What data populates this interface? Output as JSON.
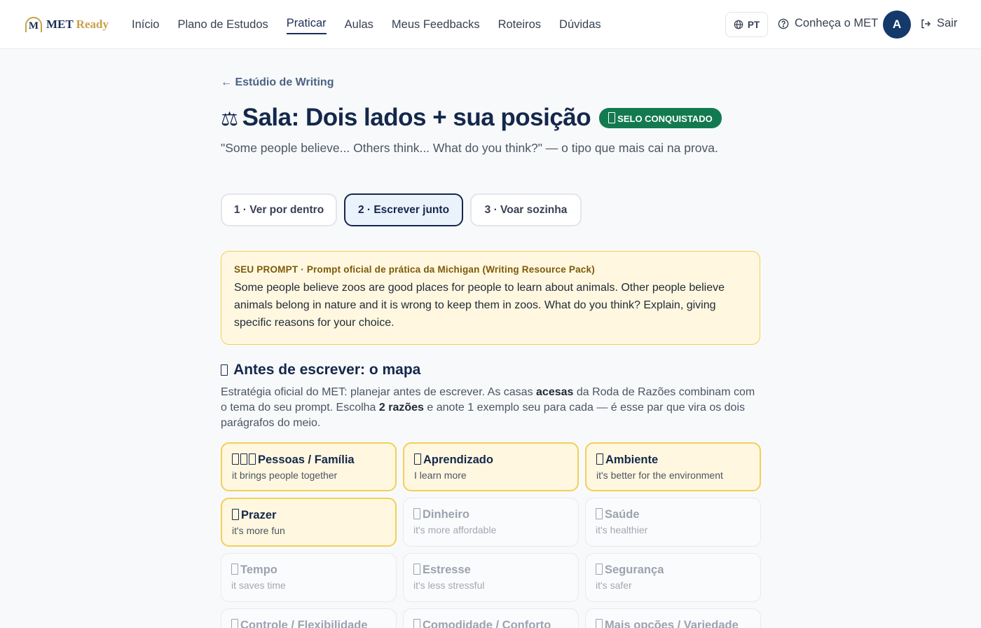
{
  "header": {
    "logo_letter": "M",
    "logo_text_a": "MET",
    "logo_text_b": "Ready",
    "nav": [
      "Início",
      "Plano de Estudos",
      "Praticar",
      "Aulas",
      "Meus Feedbacks",
      "Roteiros",
      "Dúvidas"
    ],
    "active_nav": "Praticar",
    "lang": "PT",
    "meet_label": "Conheça o MET",
    "avatar_initial": "A",
    "logout_label": "Sair"
  },
  "page": {
    "back_label": "← Estúdio de Writing",
    "title_icon": "⚖",
    "title": "Sala: Dois lados + sua posição",
    "badge": "SELO CONQUISTADO",
    "subtitle": "\"Some people believe... Others think... What do you think?\" — o tipo que mais cai na prova.",
    "steps": [
      "1 · Ver por dentro",
      "2 · Escrever junto",
      "3 · Voar sozinha"
    ],
    "active_step": 1
  },
  "prompt": {
    "label": "SEU PROMPT · Prompt oficial de prática da Michigan (Writing Resource Pack)",
    "text": "Some people believe zoos are good places for people to learn about animals. Other people believe animals belong in nature and it is wrong to keep them in zoos. What do you think? Explain, giving specific reasons for your choice."
  },
  "planning": {
    "title": "Antes de escrever: o mapa",
    "desc_1": "Estratégia oficial do MET: planejar antes de escrever. As casas ",
    "desc_b1": "acesas",
    "desc_2": " da Roda de Razões combinam com o tema do seu prompt. Escolha ",
    "desc_b2": "2 razões",
    "desc_3": " e anote 1 exemplo seu para cada — é esse par que vira os dois parágrafos do meio.",
    "reasons": [
      {
        "title": "Pessoas / Família",
        "sub": "it brings people together",
        "on": true,
        "icons": 3
      },
      {
        "title": "Aprendizado",
        "sub": "I learn more",
        "on": true,
        "icons": 1
      },
      {
        "title": "Ambiente",
        "sub": "it's better for the environment",
        "on": true,
        "icons": 1
      },
      {
        "title": "Prazer",
        "sub": "it's more fun",
        "on": true,
        "icons": 1
      },
      {
        "title": "Dinheiro",
        "sub": "it's more affordable",
        "on": false,
        "icons": 1
      },
      {
        "title": "Saúde",
        "sub": "it's healthier",
        "on": false,
        "icons": 1
      },
      {
        "title": "Tempo",
        "sub": "it saves time",
        "on": false,
        "icons": 1
      },
      {
        "title": "Estresse",
        "sub": "it's less stressful",
        "on": false,
        "icons": 1
      },
      {
        "title": "Segurança",
        "sub": "it's safer",
        "on": false,
        "icons": 1
      },
      {
        "title": "Controle / Flexibilidade",
        "sub": "",
        "on": false,
        "icons": 1
      },
      {
        "title": "Comodidade / Conforto",
        "sub": "",
        "on": false,
        "icons": 1
      },
      {
        "title": "Mais opções / Variedade",
        "sub": "",
        "on": false,
        "icons": 1
      }
    ]
  }
}
